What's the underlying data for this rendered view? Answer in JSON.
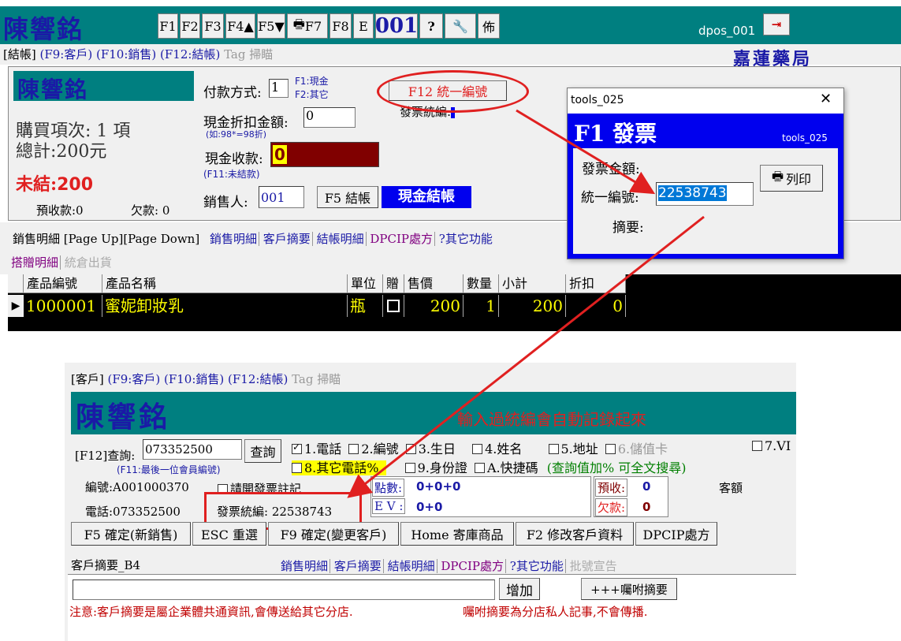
{
  "top_window": {
    "title": "陳響銘",
    "toolbar": [
      "F1",
      "F2",
      "F3",
      "F4▲",
      "F5▼",
      "F7",
      "F8",
      "E",
      "001",
      "?",
      "佈"
    ],
    "print_label": "F7",
    "user": "dpos_001",
    "store_name": "嘉蓮藥局",
    "tabs": [
      "[結帳]",
      "(F9:客戶)",
      "(F10:銷售)",
      "(F12:結帳)",
      "Tag 掃瞄"
    ],
    "checkout": {
      "customer_name": "陳響銘",
      "items_count": "購買項次: 1 項",
      "total": "總計:200元",
      "unsettled_label": "未結:",
      "unsettled_value": "200",
      "prepaid": "預收款:0",
      "owed": "欠款: 0",
      "payment_label": "付款方式:",
      "payment_value": "1",
      "payment_opt1": "F1:現金",
      "payment_opt2": "F2:其它",
      "discount_label": "現金折扣金額:",
      "discount_value": "0",
      "discount_hint": "(如:98*=98折)",
      "cash_label": "現金收款:",
      "cash_value": "0",
      "cash_hint": "(F11:未結款)",
      "seller_label": "銷售人:",
      "seller_value": "001",
      "f5_button": "F5 結帳",
      "cash_checkout": "現金結帳",
      "f12_button": "F12 統一編號",
      "invoice_label": "發票統編:"
    },
    "sales_tabs_title": "銷售明細 [Page Up][Page Down]",
    "sales_tabs": [
      "銷售明細",
      "客戶摘要",
      "結帳明細",
      "DPCIP處方",
      "?其它功能"
    ],
    "sub_tabs": [
      "搭贈明細",
      "統倉出貨"
    ],
    "grid": {
      "headers": [
        "產品編號",
        "產品名稱",
        "單位",
        "贈",
        "售價",
        "數量",
        "小計",
        "折扣"
      ],
      "rows": [
        {
          "code": "1000001",
          "name": "蜜妮卸妝乳",
          "unit": "瓶",
          "price": "200",
          "qty": "1",
          "subtotal": "200",
          "discount": "0"
        }
      ]
    }
  },
  "dialog": {
    "title": "tools_025",
    "heading": "F1 發票",
    "tag": "tools_025",
    "amount_label": "發票金額:",
    "tax_id_label": "統一編號:",
    "tax_id_value": "22538743",
    "note_label": "摘要:",
    "print_button": "列印"
  },
  "bottom_window": {
    "tabs": [
      "[客戶]",
      "(F9:客戶)",
      "(F10:銷售)",
      "(F12:結帳)",
      "Tag 掃瞄"
    ],
    "customer_name": "陳響銘",
    "banner_note": "輸入過統編會自動記錄起來",
    "query_label": "[F12]查詢:",
    "query_value": "073352500",
    "query_button": "查詢",
    "query_hint": "(F11:最後一位會員編號)",
    "options": [
      "1.電話",
      "2.編號",
      "3.生日",
      "4.姓名",
      "5.地址",
      "6.儲值卡",
      "7.VI",
      "8.其它電話%",
      "9.身份證",
      "A.快捷碼"
    ],
    "search_hint": "(查詢值加% 可全文搜尋)",
    "id_label": "編號:A001000370",
    "invoice_check": "請開發票註記",
    "phone_label": "電話:073352500",
    "invoice_tax": "發票統編: 22538743",
    "points_label": "點數:",
    "points_value": "0+0+0",
    "ev_label": "E V :",
    "ev_value": "0+0",
    "prepaid_label": "預收:",
    "prepaid_value": "0",
    "owed_label": "欠款:",
    "owed_value": "0",
    "limit_label": "客額",
    "buttons": [
      "F5 確定(新銷售)",
      "ESC 重選",
      "F9 確定(變更客戶)",
      "Home 寄庫商品",
      "F2 修改客戶資料",
      "DPCIP處方"
    ],
    "summary_title": "客戶摘要_B4",
    "summary_tabs": [
      "銷售明細",
      "客戶摘要",
      "結帳明細",
      "DPCIP處方",
      "?其它功能",
      "批號宣告"
    ],
    "add_button": "增加",
    "memo_button": "+++囑咐摘要",
    "notice": "注意:客戶摘要是屬企業體共通資訊,會傳送給其它分店.",
    "memo_notice": "囑咐摘要為分店私人記事,不會傳播."
  },
  "colors": {
    "teal": "#007f80",
    "annotation_red": "#e02020",
    "dialog_blue": "#0000ee",
    "name_blue": "#1a1aa6",
    "dark_red": "#800000"
  }
}
